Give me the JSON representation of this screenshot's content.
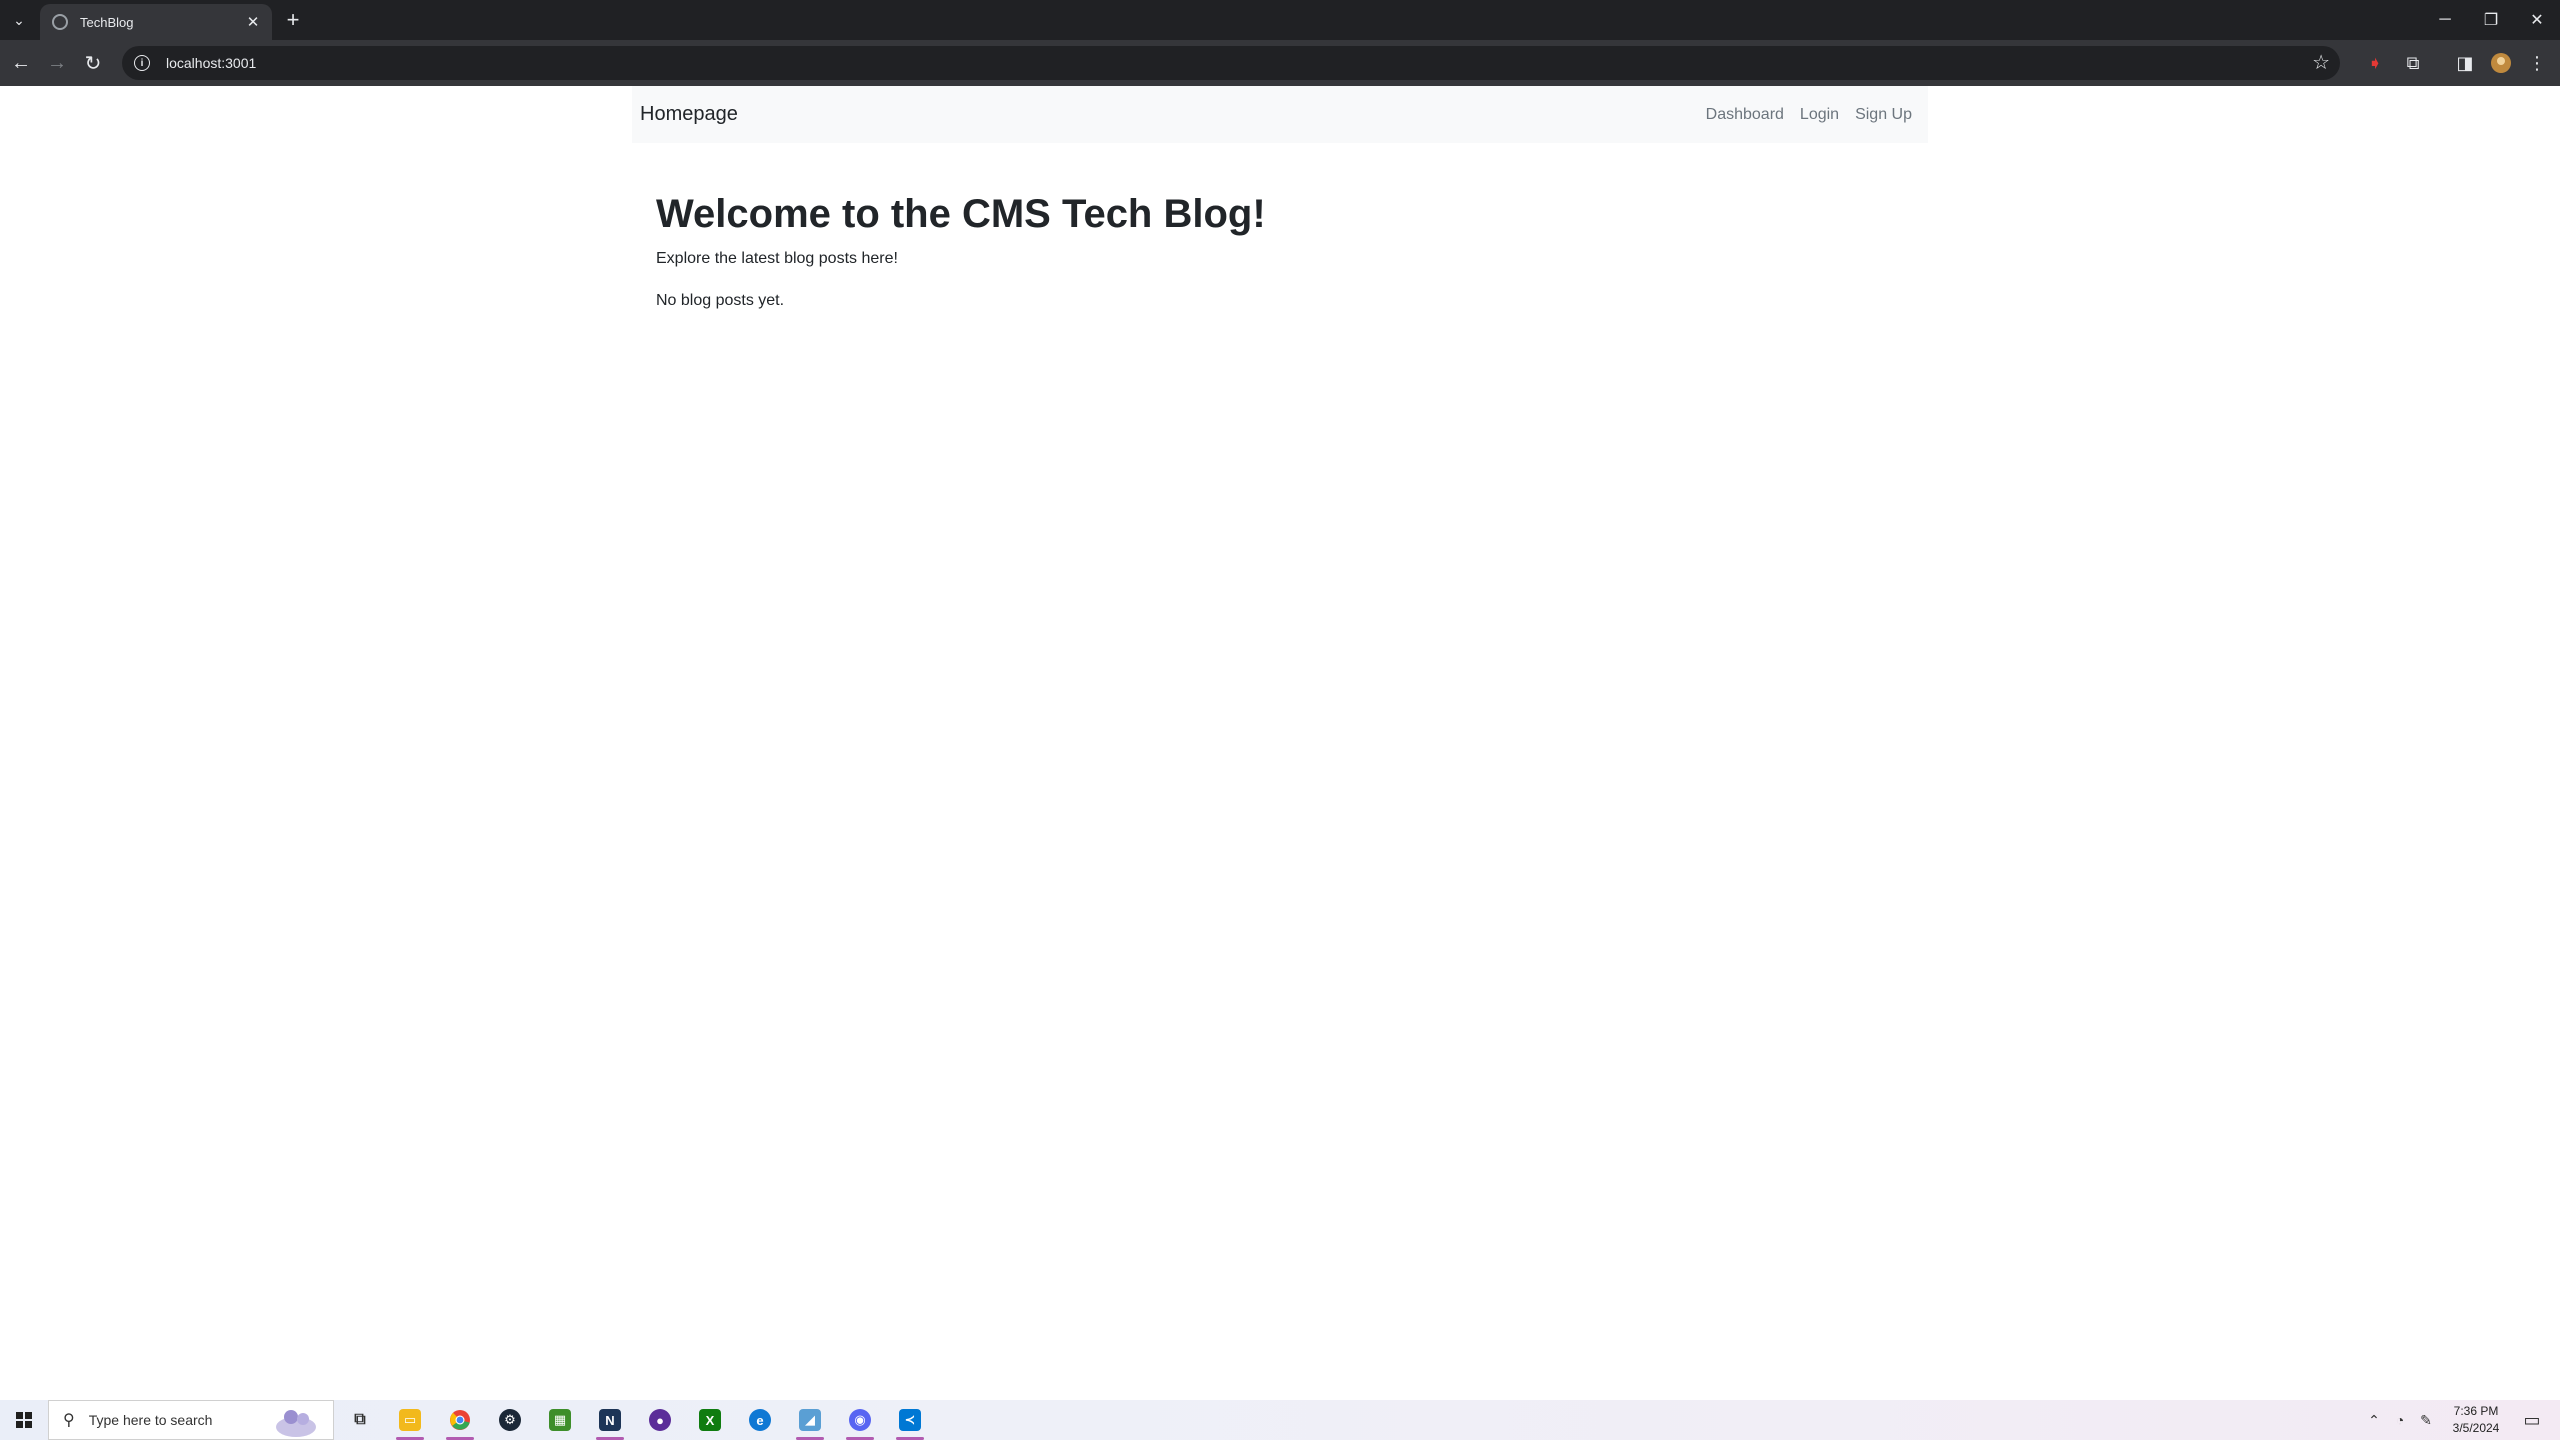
{
  "browser": {
    "tab_title": "TechBlog",
    "url": "localhost:3001"
  },
  "page": {
    "navbar": {
      "brand": "Homepage",
      "links": [
        "Dashboard",
        "Login",
        "Sign Up"
      ]
    },
    "title": "Welcome to the CMS Tech Blog!",
    "subtitle": "Explore the latest blog posts here!",
    "empty_message": "No blog posts yet."
  },
  "taskbar": {
    "search_placeholder": "Type here to search",
    "time": "7:36 PM",
    "date": "3/5/2024",
    "apps": [
      {
        "name": "task-view-icon"
      },
      {
        "name": "file-explorer-icon",
        "color": "#f2b91c"
      },
      {
        "name": "chrome-icon",
        "color": "#ea4335"
      },
      {
        "name": "steam-icon",
        "color": "#1b2838"
      },
      {
        "name": "minecraft-icon",
        "color": "#3e8e2a"
      },
      {
        "name": "app-icon",
        "color": "#1d3557"
      },
      {
        "name": "firefox-nightly-icon",
        "color": "#5b2d99"
      },
      {
        "name": "xbox-icon",
        "color": "#107c10"
      },
      {
        "name": "edge-icon",
        "color": "#0f78d4"
      },
      {
        "name": "app-icon",
        "color": "#5a9fd4"
      },
      {
        "name": "discord-icon",
        "color": "#5865f2"
      },
      {
        "name": "vscode-icon",
        "color": "#0078d4"
      }
    ]
  }
}
